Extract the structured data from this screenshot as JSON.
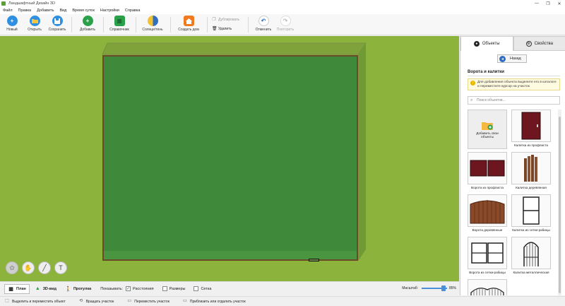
{
  "window": {
    "title": "Ландшафтный Дизайн 3D",
    "controls": [
      "—",
      "❐",
      "✕"
    ]
  },
  "menu": [
    "Файл",
    "Правка",
    "Добавить",
    "Вид",
    "Время суток",
    "Настройки",
    "Справка"
  ],
  "toolbar": {
    "new_label": "Новый",
    "open_label": "Открыть",
    "save_label": "Сохранить",
    "add_label": "Добавить",
    "reference_label": "Справочник",
    "sun_shadow_label": "Солнце/тень",
    "create_house_label": "Создать дом",
    "duplicate_label": "Дублировать",
    "delete_label": "Удалить",
    "undo_label": "Отменить",
    "redo_label": "Повторить"
  },
  "view_bar": {
    "plan_label": "План",
    "view3d_label": "3D-вид",
    "walk_label": "Прогулка",
    "show_label": "Показывать:",
    "distances_label": "Расстояния",
    "distances_checked": true,
    "sizes_label": "Размеры",
    "sizes_checked": false,
    "grid_label": "Сетка",
    "grid_checked": false,
    "zoom_label": "Масштаб:",
    "zoom_value": "85%",
    "zoom_fraction": 0.85
  },
  "status_bar": [
    {
      "icon": "cursor-icon",
      "label": "Выделить и переместить объект"
    },
    {
      "icon": "rotate-icon",
      "label": "Вращать участок"
    },
    {
      "icon": "move-icon",
      "label": "Переместить участок"
    },
    {
      "icon": "zoom-icon",
      "label": "Приблизить или отдалить участок"
    }
  ],
  "panel": {
    "tab_objects": "Объекты",
    "tab_properties": "Свойства",
    "back_label": "Назад",
    "section_title": "Ворота и калитки",
    "hint": "Для добавления объекта выделите его в каталоге и переместите курсор на участок",
    "search_placeholder": "Поиск объектов...",
    "items": [
      {
        "label": "Добавить свои объекты"
      },
      {
        "label": "Калитка из профлиста"
      },
      {
        "label": "Ворота из профлиста"
      },
      {
        "label": "Калитка деревянная"
      },
      {
        "label": "Ворота деревянные"
      },
      {
        "label": "Калитка из сетки-рабицы"
      },
      {
        "label": "Ворота из сетки-рабицы"
      },
      {
        "label": "Калитка металлическая"
      },
      {
        "label": ""
      }
    ]
  },
  "colors": {
    "lawn": "#8cb33c",
    "plot": "#3f8a3a",
    "accent_blue": "#2f6fc1"
  }
}
